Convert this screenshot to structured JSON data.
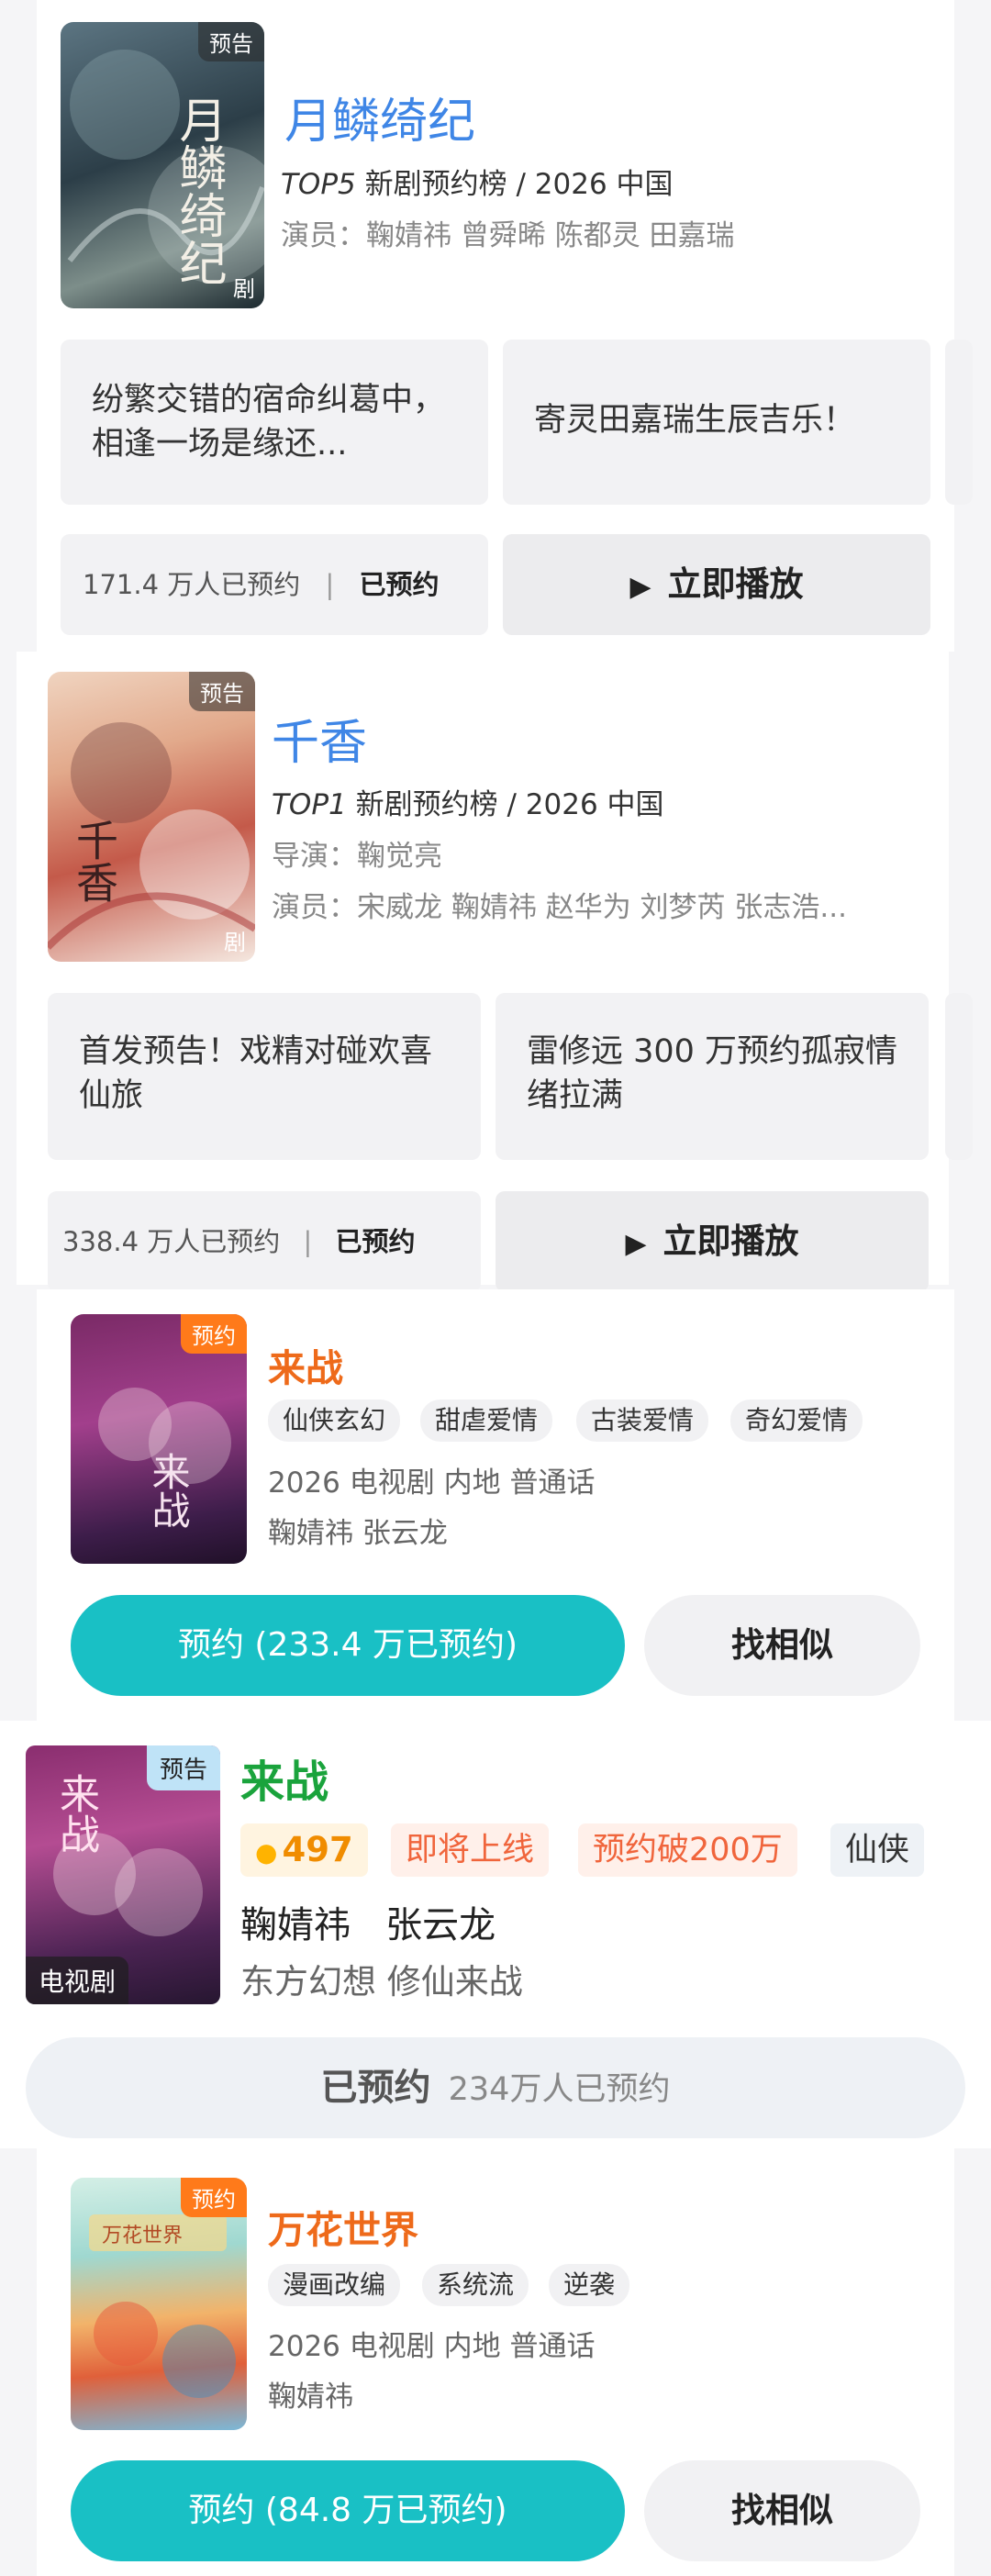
{
  "s1": {
    "poster_tag": "预告",
    "poster_corner": "剧",
    "poster_art": "月鳞绮纪",
    "title": "月鳞绮纪",
    "rank": "TOP5",
    "rank_rest": "新剧预约榜 / 2026 中国",
    "cast_label": "演员：",
    "cast": "鞠婧祎 曾舜晞 陈都灵 田嘉瑞",
    "hl1": "纷繁交错的宿命纠葛中，相逢一场是缘还...",
    "hl2": "寄灵田嘉瑞生辰吉乐！",
    "count": "171.4 万人已预约",
    "status": "已预约",
    "play": "立即播放"
  },
  "s2": {
    "poster_tag": "预告",
    "poster_corner": "剧",
    "poster_art": "千香",
    "title": "千香",
    "rank": "TOP1",
    "rank_rest": "新剧预约榜 / 2026 中国",
    "director_label": "导演：",
    "director": "鞠觉亮",
    "cast_label": "演员：",
    "cast": "宋威龙 鞠婧祎 赵华为 刘梦芮 张志浩...",
    "hl1": "首发预告！戏精对碰欢喜仙旅",
    "hl2": "雷修远 300 万预约孤寂情绪拉满",
    "count": "338.4 万人已预约",
    "status": "已预约",
    "play": "立即播放"
  },
  "s3": {
    "poster_tag": "预约",
    "poster_art": "来战",
    "title": "来战",
    "tags": [
      "仙侠玄幻",
      "甜虐爱情",
      "古装爱情",
      "奇幻爱情"
    ],
    "info": "2026 电视剧 内地 普通话",
    "cast": "鞠婧祎 张云龙",
    "reserve": "预约 (233.4 万已预约)",
    "similar": "找相似"
  },
  "s4": {
    "poster_tag": "预告",
    "poster_bottom": "电视剧",
    "poster_art": "来战",
    "title": "来战",
    "heat": "497",
    "badges": [
      "即将上线",
      "预约破200万",
      "仙侠"
    ],
    "cast": "鞠婧祎   张云龙",
    "desc": "东方幻想 修仙来战",
    "reserved": "已预约",
    "reserved_count": "234万人已预约"
  },
  "s5": {
    "poster_tag": "预约",
    "poster_art": "万花世界",
    "title": "万花世界",
    "tags": [
      "漫画改编",
      "系统流",
      "逆袭"
    ],
    "info": "2026 电视剧 内地 普通话",
    "cast": "鞠婧祎",
    "reserve": "预约 (84.8 万已预约)",
    "similar": "找相似"
  },
  "colors": {
    "blue_title": "#3f86e6",
    "orange_title": "#ee6a1a",
    "green_title": "#1aa33c",
    "teal_button": "#19c0c5",
    "page_grey": "#f2f2f4"
  }
}
